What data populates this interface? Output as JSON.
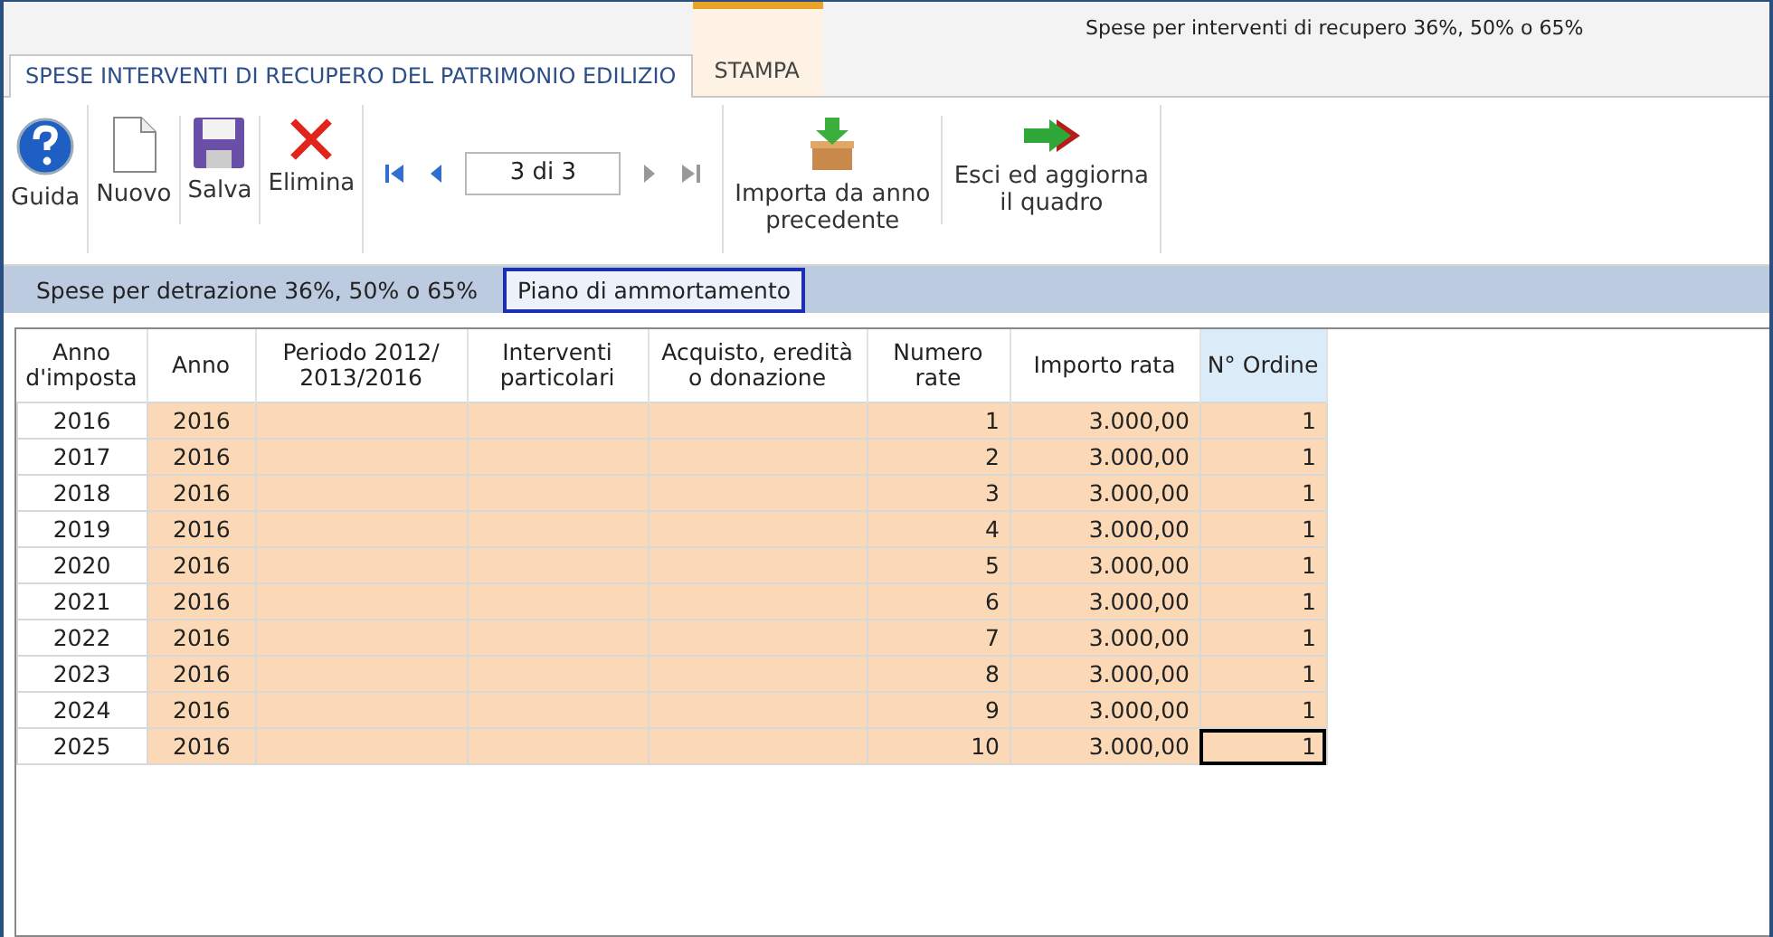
{
  "window": {
    "title": "Spese per interventi di recupero 36%, 50% o 65%"
  },
  "tabs": [
    {
      "label": "SPESE INTERVENTI DI RECUPERO DEL PATRIMONIO EDILIZIO",
      "selected": true,
      "kind": "normal"
    },
    {
      "label": "STAMPA",
      "selected": false,
      "kind": "contextual"
    }
  ],
  "toolbar": [
    {
      "kind": "help",
      "label": "Guida"
    },
    {
      "kind": "new",
      "label": "Nuovo"
    },
    {
      "kind": "save",
      "label": "Salva"
    },
    {
      "kind": "delete",
      "label": "Elimina"
    }
  ],
  "navigator": {
    "record": "3 di 3",
    "first_disabled": false,
    "prev_disabled": false,
    "next_disabled": true,
    "last_disabled": true
  },
  "actions": [
    {
      "kind": "import",
      "label": "Importa da anno precedente"
    },
    {
      "kind": "exit",
      "label": "Esci ed aggiorna il quadro"
    }
  ],
  "subtabs": [
    {
      "label": "Spese per detrazione 36%, 50% o 65%",
      "selected": false
    },
    {
      "label": "Piano di ammortamento",
      "selected": true
    }
  ],
  "table": {
    "columns": [
      {
        "label": "Anno d'imposta",
        "editable": false
      },
      {
        "label": "Anno",
        "editable": true
      },
      {
        "label": "Periodo 2012/ 2013/2016",
        "editable": true
      },
      {
        "label": "Interventi particolari",
        "editable": true
      },
      {
        "label": "Acquisto, eredità o donazione",
        "editable": true
      },
      {
        "label": "Numero rate",
        "editable": true
      },
      {
        "label": "Importo rata",
        "editable": true
      },
      {
        "label": "N° Ordine",
        "editable": true
      }
    ],
    "rows": [
      {
        "cells": [
          "2016",
          "2016",
          "",
          "",
          "",
          "1",
          "3.000,00",
          "1"
        ],
        "selected": false
      },
      {
        "cells": [
          "2017",
          "2016",
          "",
          "",
          "",
          "2",
          "3.000,00",
          "1"
        ],
        "selected": false
      },
      {
        "cells": [
          "2018",
          "2016",
          "",
          "",
          "",
          "3",
          "3.000,00",
          "1"
        ],
        "selected": false
      },
      {
        "cells": [
          "2019",
          "2016",
          "",
          "",
          "",
          "4",
          "3.000,00",
          "1"
        ],
        "selected": false
      },
      {
        "cells": [
          "2020",
          "2016",
          "",
          "",
          "",
          "5",
          "3.000,00",
          "1"
        ],
        "selected": false
      },
      {
        "cells": [
          "2021",
          "2016",
          "",
          "",
          "",
          "6",
          "3.000,00",
          "1"
        ],
        "selected": false
      },
      {
        "cells": [
          "2022",
          "2016",
          "",
          "",
          "",
          "7",
          "3.000,00",
          "1"
        ],
        "selected": false
      },
      {
        "cells": [
          "2023",
          "2016",
          "",
          "",
          "",
          "8",
          "3.000,00",
          "1"
        ],
        "selected": false
      },
      {
        "cells": [
          "2024",
          "2016",
          "",
          "",
          "",
          "9",
          "3.000,00",
          "1"
        ],
        "selected": false
      },
      {
        "cells": [
          "2025",
          "2016",
          "",
          "",
          "",
          "10",
          "3.000,00",
          "1"
        ],
        "selected": true
      }
    ]
  }
}
